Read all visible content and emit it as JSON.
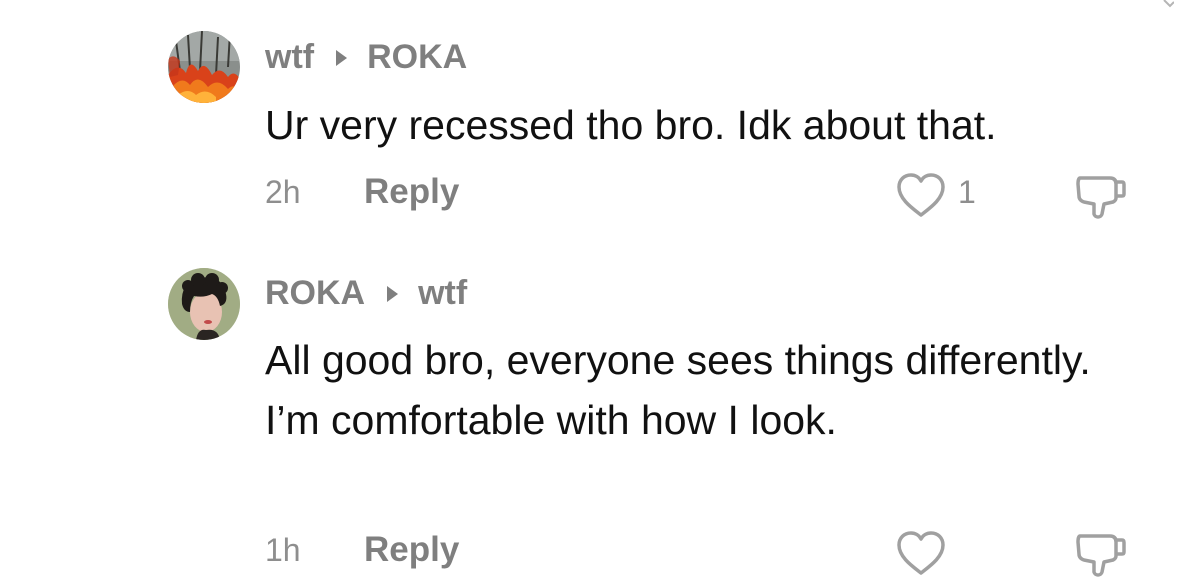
{
  "comments": [
    {
      "author": "wtf",
      "reply_to": "ROKA",
      "avatar_icon": "fire-forest-avatar",
      "text": "Ur very recessed tho bro. Idk about that.",
      "time": "2h",
      "reply_label": "Reply",
      "like_count": "1",
      "like_icon": "heart-outline-icon",
      "dislike_icon": "thumbs-down-icon"
    },
    {
      "author": "ROKA",
      "reply_to": "wtf",
      "avatar_icon": "person-portrait-avatar",
      "text": "All good bro, everyone sees things differently. I’m comfortable with how I look.",
      "time": "1h",
      "reply_label": "Reply",
      "like_count": "",
      "like_icon": "heart-outline-icon",
      "dislike_icon": "thumbs-down-icon"
    }
  ],
  "colors": {
    "primary_text": "#111111",
    "secondary_text": "#7f7f7f",
    "meta_text": "#8e8e8e",
    "icon_stroke": "#a0a0a0"
  }
}
